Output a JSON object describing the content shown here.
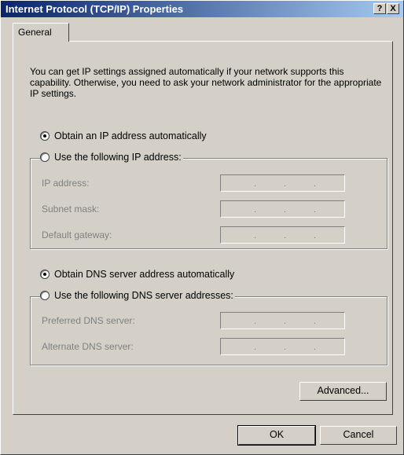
{
  "window": {
    "title": "Internet Protocol (TCP/IP) Properties",
    "help_label": "?",
    "close_label": "X"
  },
  "tabs": [
    {
      "label": "General",
      "active": true
    }
  ],
  "intro_text": "You can get IP settings assigned automatically if your network supports this capability. Otherwise, you need to ask your network administrator for the appropriate IP settings.",
  "ip": {
    "auto_label": "Obtain an IP address automatically",
    "auto_selected": true,
    "manual_label": "Use the following IP address:",
    "manual_selected": false,
    "fields": [
      {
        "label": "IP address:"
      },
      {
        "label": "Subnet mask:"
      },
      {
        "label": "Default gateway:"
      }
    ]
  },
  "dns": {
    "auto_label": "Obtain DNS server address automatically",
    "auto_selected": true,
    "manual_label": "Use the following DNS server addresses:",
    "manual_selected": false,
    "fields": [
      {
        "label": "Preferred DNS server:"
      },
      {
        "label": "Alternate DNS server:"
      }
    ]
  },
  "buttons": {
    "advanced": "Advanced...",
    "ok": "OK",
    "cancel": "Cancel"
  },
  "ip_separator": "."
}
